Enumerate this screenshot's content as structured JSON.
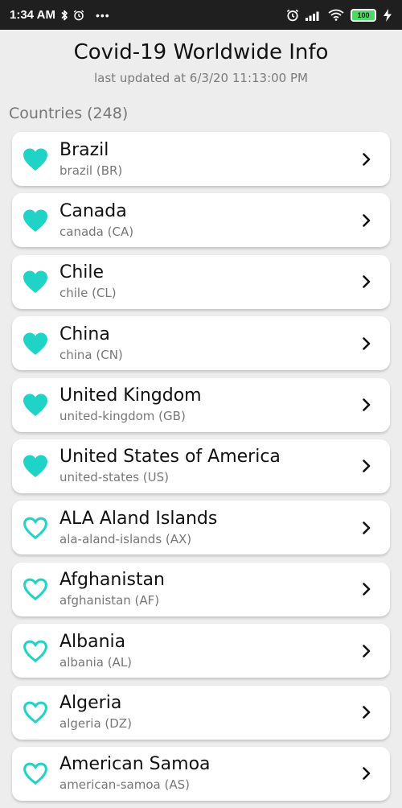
{
  "status_bar": {
    "time": "1:34 AM",
    "dots": "•••",
    "battery": "100"
  },
  "header": {
    "title": "Covid-19 Worldwide Info",
    "last_updated": "last updated at 6/3/20 11:13:00 PM"
  },
  "section": {
    "title": "Countries (248)"
  },
  "colors": {
    "accent": "#1fd3c6",
    "status_bar": "#1f1f1f",
    "background": "#ededed"
  },
  "countries": [
    {
      "name": "Brazil",
      "slug": "brazil (BR)",
      "favorite": true,
      "icon": "heart-filled-icon"
    },
    {
      "name": "Canada",
      "slug": "canada (CA)",
      "favorite": true,
      "icon": "heart-filled-icon"
    },
    {
      "name": "Chile",
      "slug": "chile (CL)",
      "favorite": true,
      "icon": "heart-filled-icon"
    },
    {
      "name": "China",
      "slug": "china (CN)",
      "favorite": true,
      "icon": "heart-filled-icon"
    },
    {
      "name": "United Kingdom",
      "slug": "united-kingdom (GB)",
      "favorite": true,
      "icon": "heart-filled-icon"
    },
    {
      "name": "United States of America",
      "slug": "united-states (US)",
      "favorite": true,
      "icon": "heart-filled-icon"
    },
    {
      "name": "ALA Aland Islands",
      "slug": "ala-aland-islands (AX)",
      "favorite": false,
      "icon": "heart-outline-icon"
    },
    {
      "name": "Afghanistan",
      "slug": "afghanistan (AF)",
      "favorite": false,
      "icon": "heart-outline-icon"
    },
    {
      "name": "Albania",
      "slug": "albania (AL)",
      "favorite": false,
      "icon": "heart-outline-icon"
    },
    {
      "name": "Algeria",
      "slug": "algeria (DZ)",
      "favorite": false,
      "icon": "heart-outline-icon"
    },
    {
      "name": "American Samoa",
      "slug": "american-samoa (AS)",
      "favorite": false,
      "icon": "heart-outline-icon"
    }
  ]
}
